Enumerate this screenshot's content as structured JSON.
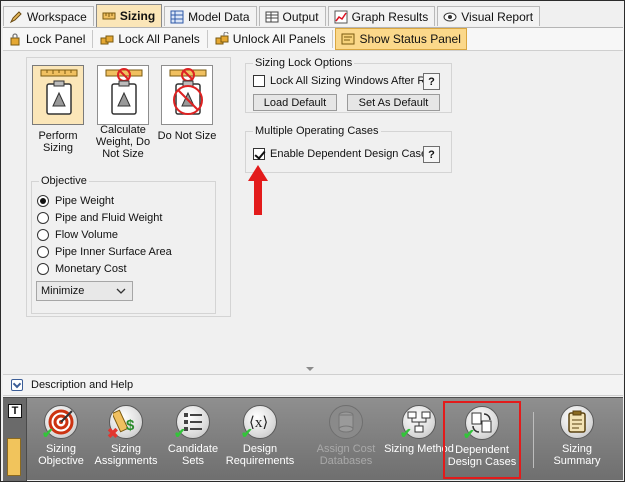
{
  "tabs": [
    {
      "label": "Workspace",
      "icon": "pencil-icon"
    },
    {
      "label": "Sizing",
      "icon": "ruler-icon"
    },
    {
      "label": "Model Data",
      "icon": "grid-icon"
    },
    {
      "label": "Output",
      "icon": "table-icon"
    },
    {
      "label": "Graph Results",
      "icon": "chart-icon"
    },
    {
      "label": "Visual Report",
      "icon": "eye-icon"
    }
  ],
  "toolbar": {
    "lock_panel": "Lock Panel",
    "lock_all": "Lock All Panels",
    "unlock_all": "Unlock All Panels",
    "show_status": "Show Status Panel"
  },
  "sizing": {
    "perform": "Perform Sizing",
    "calculate_weight": "Calculate Weight, Do Not Size",
    "do_not_size": "Do Not Size"
  },
  "lock_options": {
    "title": "Sizing Lock Options",
    "lock_all_label": "Lock All Sizing Windows After Run",
    "help": "?",
    "load_default": "Load Default",
    "set_default": "Set As Default"
  },
  "multiple_cases": {
    "title": "Multiple Operating Cases",
    "enable_label": "Enable Dependent Design Cases",
    "help": "?"
  },
  "objective": {
    "title": "Objective",
    "options": [
      "Pipe Weight",
      "Pipe and Fluid Weight",
      "Flow Volume",
      "Pipe Inner Surface Area",
      "Monetary Cost"
    ],
    "selected": "Pipe Weight",
    "mode": "Minimize"
  },
  "description": {
    "label": "Description and Help"
  },
  "nav": {
    "side_label": "T",
    "items": [
      {
        "label": "Sizing Objective"
      },
      {
        "label": "Sizing Assignments"
      },
      {
        "label": "Candidate Sets"
      },
      {
        "label": "Design Requirements"
      },
      {
        "label": "Assign Cost Databases"
      },
      {
        "label": "Sizing Method"
      },
      {
        "label": "Dependent Design Cases"
      },
      {
        "label": "Sizing Summary"
      }
    ]
  },
  "colors": {
    "accent": "#fbe6b8",
    "highlight_red": "#e31b1b",
    "check_green": "#33c43a"
  }
}
